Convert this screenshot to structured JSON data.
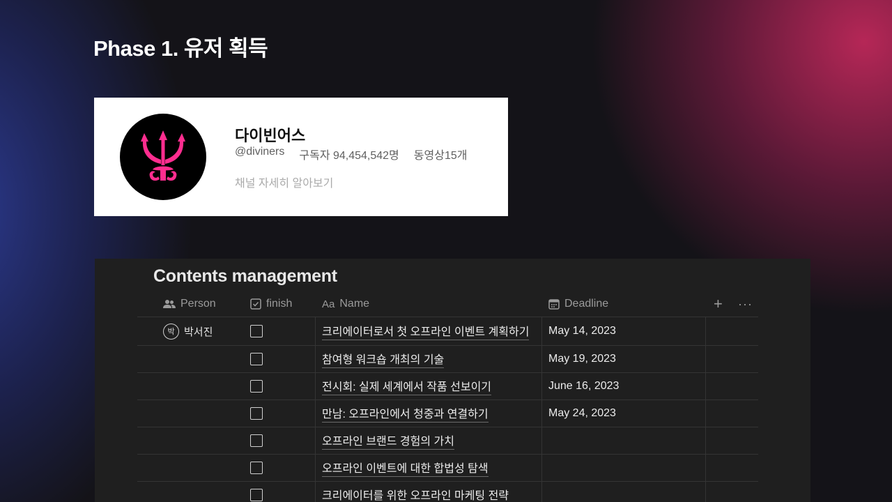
{
  "slide": {
    "title": "Phase 1. 유저 획득"
  },
  "channel": {
    "name": "다이빈어스",
    "handle": "@diviners",
    "subscribers": "구독자 94,454,542명",
    "videos": "동영상15개",
    "more_link": "채널 자세히 알아보기",
    "logo_icon": "trident-icon",
    "logo_color": "#ff2d8f"
  },
  "database": {
    "title": "Contents management",
    "columns": [
      {
        "label": "Person",
        "icon": "people-icon"
      },
      {
        "label": "finish",
        "icon": "checkbox-icon"
      },
      {
        "label": "Name",
        "icon": "text-aa-icon",
        "icon_text": "Aa"
      },
      {
        "label": "Deadline",
        "icon": "calendar-icon"
      }
    ],
    "add_column": "+",
    "more": "···",
    "rows": [
      {
        "person_initial": "박",
        "person": "박서진",
        "finish": false,
        "name": "크리에이터로서 첫 오프라인 이벤트 계획하기",
        "deadline": "May 14, 2023"
      },
      {
        "person_initial": "",
        "person": "",
        "finish": false,
        "name": "참여형 워크숍 개최의 기술",
        "deadline": "May 19, 2023"
      },
      {
        "person_initial": "",
        "person": "",
        "finish": false,
        "name": "전시회: 실제 세계에서 작품 선보이기",
        "deadline": "June 16, 2023"
      },
      {
        "person_initial": "",
        "person": "",
        "finish": false,
        "name": "만남: 오프라인에서 청중과 연결하기",
        "deadline": "May 24, 2023"
      },
      {
        "person_initial": "",
        "person": "",
        "finish": false,
        "name": "오프라인 브랜드 경험의 가치",
        "deadline": ""
      },
      {
        "person_initial": "",
        "person": "",
        "finish": false,
        "name": "오프라인 이벤트에 대한 합법성 탐색",
        "deadline": ""
      },
      {
        "person_initial": "",
        "person": "",
        "finish": false,
        "name": "크리에이터를 위한 오프라인 마케팅 전략",
        "deadline": ""
      }
    ]
  }
}
